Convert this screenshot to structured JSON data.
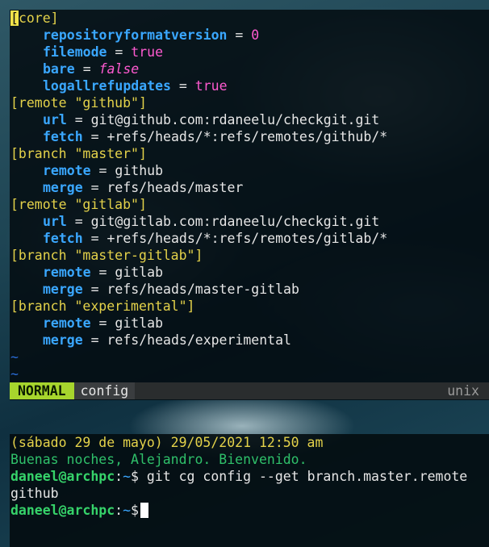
{
  "editor": {
    "lines": [
      {
        "type": "section",
        "text": "[core]"
      },
      {
        "type": "kv",
        "key": "repositoryformatversion",
        "op": "=",
        "value": "0",
        "vclass": "num"
      },
      {
        "type": "kv",
        "key": "filemode",
        "op": "=",
        "value": "true",
        "vclass": "bool"
      },
      {
        "type": "kv",
        "key": "bare",
        "op": "=",
        "value": "false",
        "vclass": "boolf"
      },
      {
        "type": "kv",
        "key": "logallrefupdates",
        "op": "=",
        "value": "true",
        "vclass": "bool"
      },
      {
        "type": "section",
        "text": "[remote \"github\"]"
      },
      {
        "type": "kv",
        "key": "url",
        "op": "=",
        "value": "git@github.com:rdaneelu/checkgit.git",
        "vclass": "val"
      },
      {
        "type": "kv",
        "key": "fetch",
        "op": "=",
        "value": "+refs/heads/*:refs/remotes/github/*",
        "vclass": "val"
      },
      {
        "type": "section",
        "text": "[branch \"master\"]"
      },
      {
        "type": "kv",
        "key": "remote",
        "op": "=",
        "value": "github",
        "vclass": "val"
      },
      {
        "type": "kv",
        "key": "merge",
        "op": "=",
        "value": "refs/heads/master",
        "vclass": "val"
      },
      {
        "type": "section",
        "text": "[remote \"gitlab\"]"
      },
      {
        "type": "kv",
        "key": "url",
        "op": "=",
        "value": "git@gitlab.com:rdaneelu/checkgit.git",
        "vclass": "val"
      },
      {
        "type": "kv",
        "key": "fetch",
        "op": "=",
        "value": "+refs/heads/*:refs/remotes/gitlab/*",
        "vclass": "val"
      },
      {
        "type": "section",
        "text": "[branch \"master-gitlab\"]"
      },
      {
        "type": "kv",
        "key": "remote",
        "op": "=",
        "value": "gitlab",
        "vclass": "val"
      },
      {
        "type": "kv",
        "key": "merge",
        "op": "=",
        "value": "refs/heads/master-gitlab",
        "vclass": "val"
      },
      {
        "type": "section",
        "text": "[branch \"experimental\"]"
      },
      {
        "type": "kv",
        "key": "remote",
        "op": "=",
        "value": "gitlab",
        "vclass": "val"
      },
      {
        "type": "kv",
        "key": "merge",
        "op": "=",
        "value": "refs/heads/experimental",
        "vclass": "val"
      },
      {
        "type": "tilde",
        "text": "~"
      },
      {
        "type": "tilde",
        "text": "~"
      }
    ],
    "status": {
      "mode": "NORMAL",
      "filename": "config",
      "fileformat": "unix"
    }
  },
  "terminal": {
    "date_line": "(sábado 29 de mayo) 29/05/2021 12:50 am",
    "greeting": "Buenas noches, Alejandro. Bienvenido.",
    "prompt_user": "daneel@archpc",
    "prompt_sep": ":",
    "prompt_path": "~",
    "prompt_symbol": "$",
    "command": "git cg config --get branch.master.remote",
    "output": "github"
  }
}
